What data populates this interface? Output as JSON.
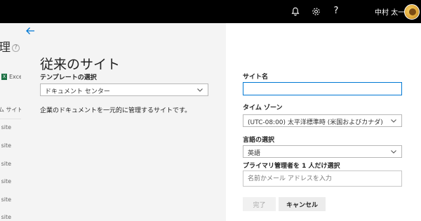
{
  "topbar": {
    "username": "中村 太一",
    "help_glyph": "?",
    "icons": [
      "bell-icon",
      "gear-icon",
      "help-icon"
    ]
  },
  "background_page": {
    "title_fragment": "理",
    "excel_label": "Exce",
    "column_header": "ム サイト",
    "rows": [
      "n site",
      "n site",
      "n site",
      "n site",
      "n site",
      "n site"
    ]
  },
  "panel": {
    "title": "従来のサイト",
    "template": {
      "label": "テンプレートの選択",
      "value": "ドキュメント センター",
      "description": "企業のドキュメントを一元的に管理するサイトです。"
    },
    "site_name": {
      "label": "サイト名",
      "value": ""
    },
    "time_zone": {
      "label": "タイム ゾーン",
      "value": "(UTC-08:00) 太平洋標準時 (米国およびカナダ)"
    },
    "language": {
      "label": "言語の選択",
      "value": "英語"
    },
    "primary_admin": {
      "label": "プライマリ管理者を 1 人だけ選択",
      "placeholder": "名前かメール アドレスを入力"
    },
    "buttons": {
      "done": "完了",
      "cancel": "キャンセル"
    }
  },
  "colors": {
    "topbar": "#000000",
    "accent": "#0078d4",
    "panel_left_bg": "#f4f4f4"
  }
}
